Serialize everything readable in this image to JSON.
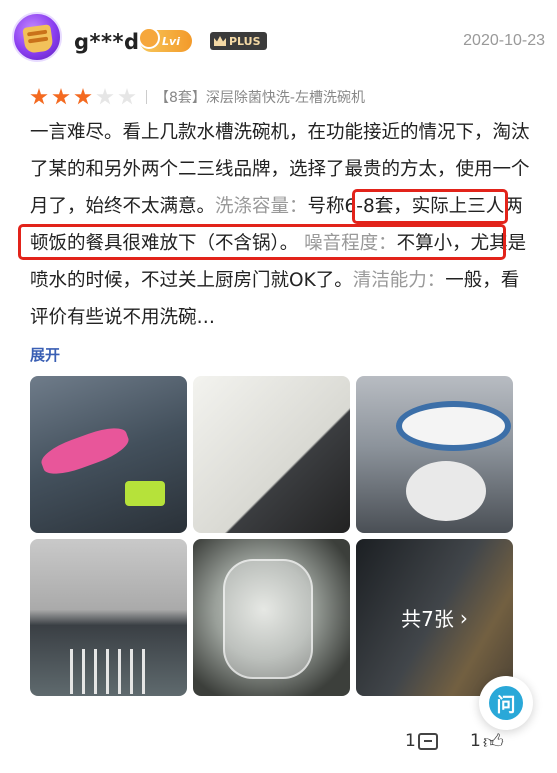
{
  "user": {
    "name": "g***d",
    "level_badge": "Lvi",
    "plus_badge": "PLUS",
    "date": "2020-10-23"
  },
  "rating": {
    "stars": 3,
    "max": 5
  },
  "product_spec": "【8套】深层除菌快洗-左槽洗碗机",
  "review": {
    "text_part1": "一言难尽。看上几款水槽洗碗机，在功能接近的情况下，淘汰了某的和另外两个二三线品牌，选择了最贵的方太，使用一个月了，始终不太满意。",
    "capacity_label": "洗涤容量：",
    "capacity_text": "号称6-8套，实际上三人两顿饭的餐具很难放下（不含锅）。",
    "noise_label": "噪音程度：",
    "noise_text": "不算小，尤其是喷水的时候，不过关上厨房门就OK了。",
    "clean_label": "清洁能力：",
    "clean_text": "一般，看评价有些说不用洗碗…"
  },
  "expand_label": "展开",
  "gallery": {
    "total_label": "共7张",
    "chevron": "›"
  },
  "ask_button": "问",
  "actions": {
    "comment_count": "1",
    "like_count": "1"
  },
  "colors": {
    "accent_star": "#f46a20",
    "highlight_border": "#e2231a",
    "link_blue": "#3a5fb4",
    "ask_blue": "#2aa8d8"
  }
}
